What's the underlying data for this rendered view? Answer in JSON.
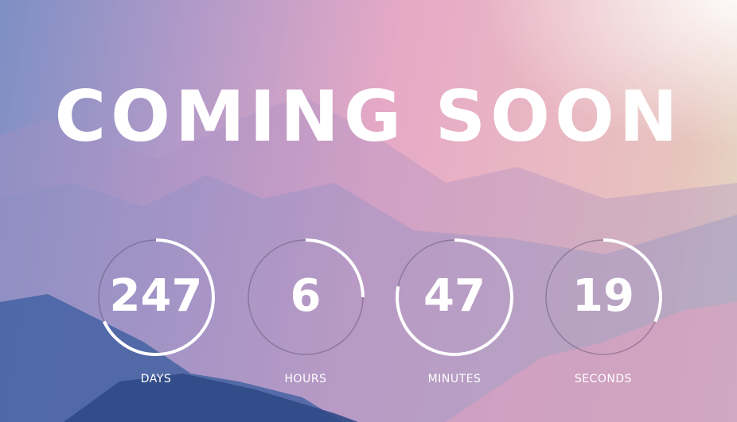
{
  "title": "COMING SOON",
  "countdown": [
    {
      "value": "247",
      "label": "DAYS",
      "progress": 0.68
    },
    {
      "value": "6",
      "label": "HOURS",
      "progress": 0.25
    },
    {
      "value": "47",
      "label": "MINUTES",
      "progress": 0.78
    },
    {
      "value": "19",
      "label": "SECONDS",
      "progress": 0.32
    }
  ]
}
